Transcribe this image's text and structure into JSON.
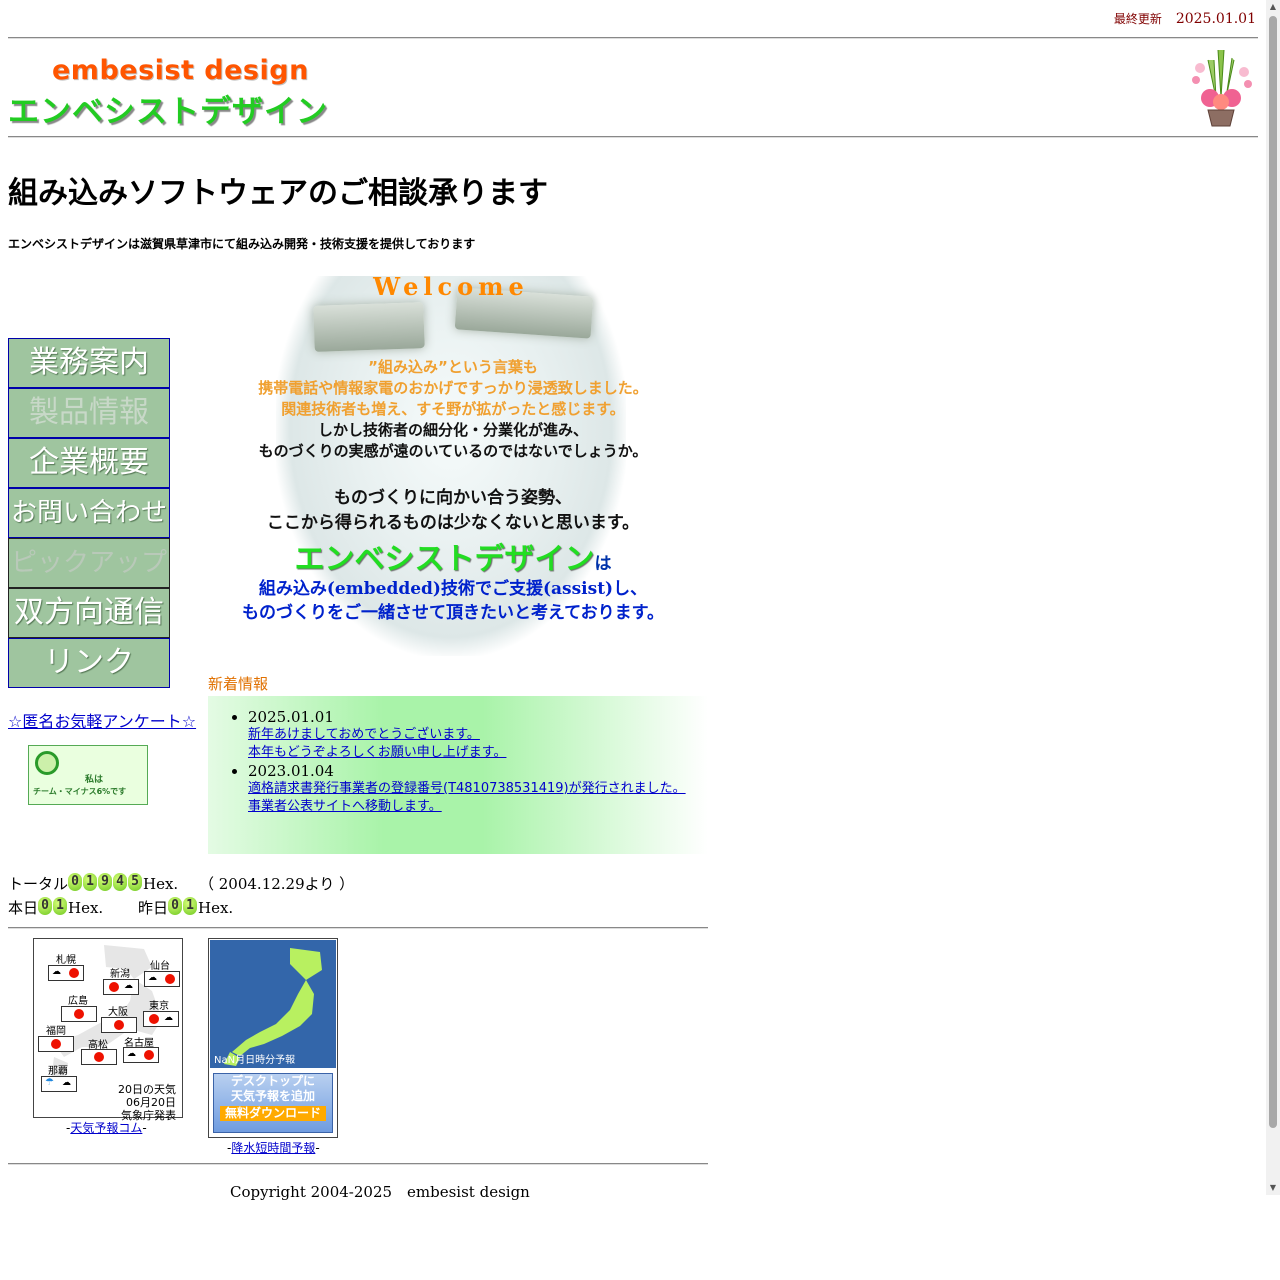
{
  "header": {
    "last_updated_label": "最終更新",
    "last_updated_date": "2025.01.01",
    "logo_en": "embesist design",
    "logo_jp": "エンベシストデザイン"
  },
  "headline": "組み込みソフトウェアのご相談承ります",
  "subline": "エンベシストデザインは滋賀県草津市にて組み込み開発・技術支援を提供しております",
  "nav": {
    "items": [
      {
        "label": "業務案内"
      },
      {
        "label": "製品情報"
      },
      {
        "label": "企業概要"
      },
      {
        "label": "お問い合わせ"
      },
      {
        "label": "ピックアップ"
      },
      {
        "label": "双方向通信"
      },
      {
        "label": "リンク"
      }
    ]
  },
  "hero": {
    "welcome": "Welcome",
    "line1": "”組み込み”という言葉も",
    "line2": "携帯電話や情報家電のおかげですっかり浸透致しました。",
    "line3": "関連技術者も増え、すそ野が拡がったと感じます。",
    "line4": "しかし技術者の細分化・分業化が進み、",
    "line5": "ものづくりの実感が遠のいているのではないでしょうか。",
    "line6": "ものづくりに向かい合う姿勢、",
    "line7": "ここから得られるものは少なくないと思います。",
    "brand": "エンベシストデザイン",
    "brand_suffix": "は",
    "line8": "組み込み(embedded)技術でご支援(assist)し、",
    "line9": "ものづくりをご一緒させて頂きたいと考えております。"
  },
  "news": {
    "title": "新着情報",
    "items": [
      {
        "date": "2025.01.01",
        "line1": "新年あけましておめでとうございます。",
        "line2": "本年もどうぞよろしくお願い申し上げます。"
      },
      {
        "date": "2023.01.04",
        "line1": "適格請求書発行事業者の登録番号(T4810738531419)が発行されました。",
        "line2": "事業者公表サイトへ移動します。"
      }
    ]
  },
  "sidebar": {
    "survey": "☆匿名お気軽アンケート☆",
    "badge_line1": "私は",
    "badge_line2": "チーム・マイナス6%です"
  },
  "counters": {
    "total_label": "トータル",
    "total_digits": [
      "0",
      "1",
      "9",
      "4",
      "5"
    ],
    "hex": "Hex.",
    "since": "（ 2004.12.29より ）",
    "today_label": "本日",
    "today_digits": [
      "0",
      "1"
    ],
    "yesterday_label": "昨日",
    "yesterday_digits": [
      "0",
      "1"
    ]
  },
  "weather": {
    "cities": [
      "札幌",
      "新潟",
      "仙台",
      "広島",
      "大阪",
      "東京",
      "福岡",
      "高松",
      "名古屋",
      "那覇"
    ],
    "forecast_line1": "20日の天気",
    "forecast_line2": "06月20日気象庁発表",
    "caption_prefix": "-",
    "caption_link": "天気予報コム",
    "caption_suffix": "-"
  },
  "rain": {
    "time": "NaN月日時分予報",
    "download_line1": "デスクトップに",
    "download_line2": "天気予報を追加",
    "download_free": "無料ダウンロード",
    "caption_prefix": "-",
    "caption_link": "降水短時間予報",
    "caption_suffix": "-"
  },
  "footer": {
    "copyright": "Copyright 2004-2025　embesist design"
  },
  "colors": {
    "accent_orange": "#ff8800",
    "brand_green": "#22cc22",
    "link_blue": "#0000cc",
    "nav_bg": "#9fc59f"
  }
}
